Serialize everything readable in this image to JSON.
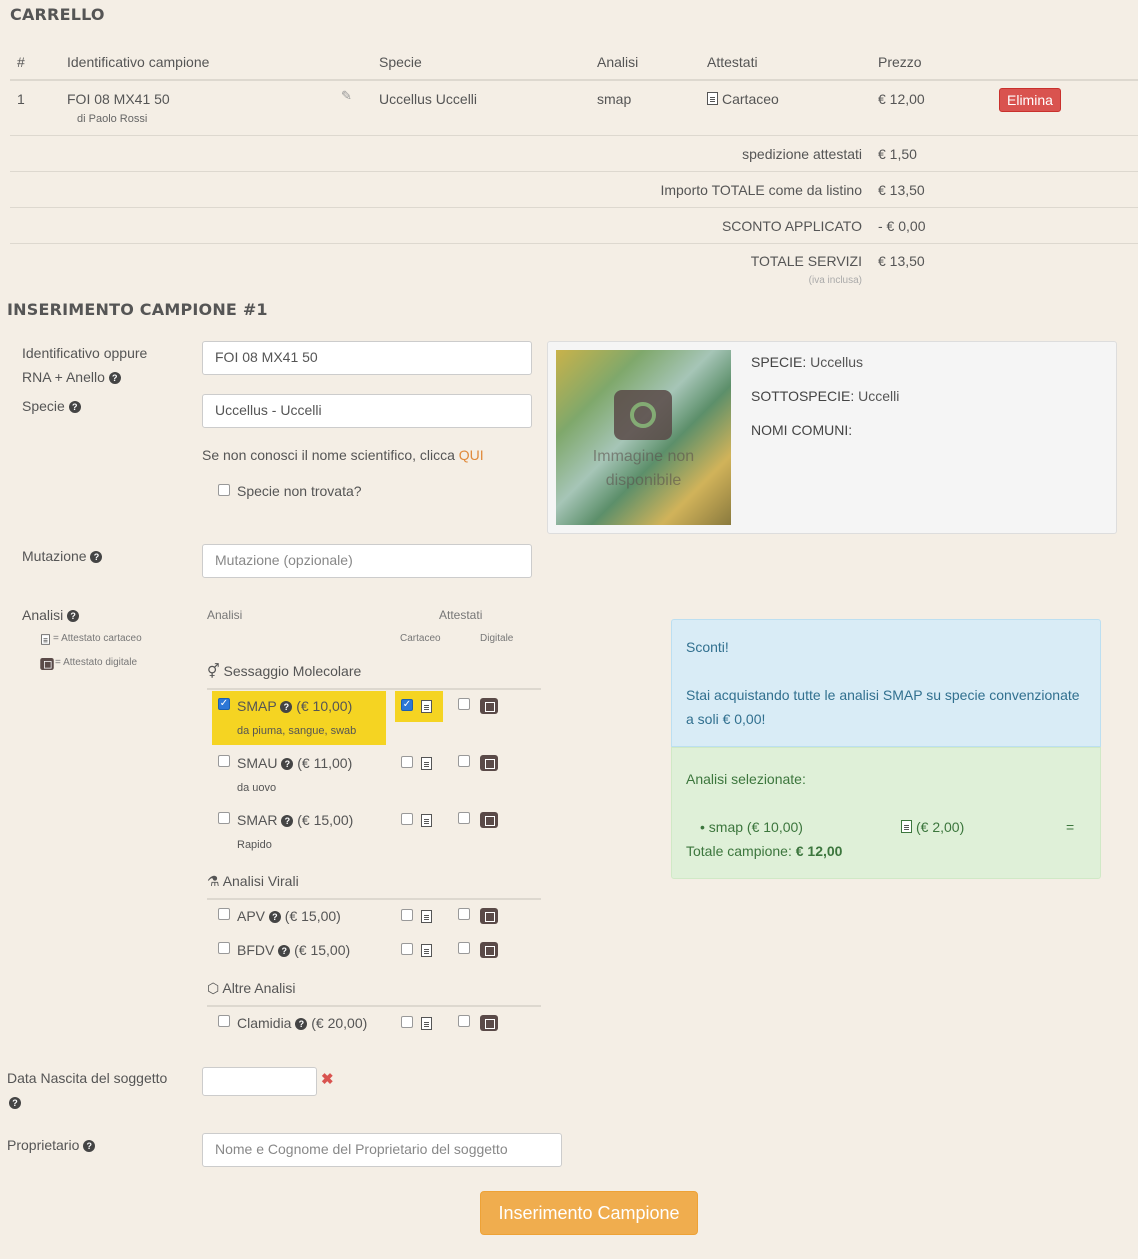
{
  "cart": {
    "title": "CARRELLO",
    "headers": [
      "#",
      "Identificativo campione",
      "Specie",
      "Analisi",
      "Attestati",
      "Prezzo"
    ],
    "row": {
      "num": "1",
      "id": "FOI 08 MX41 50",
      "by": "di Paolo Rossi",
      "species": "Uccellus Uccelli",
      "analysis": "smap",
      "cert": "Cartaceo",
      "price": "€ 12,00",
      "delete_label": "Elimina"
    },
    "summary": [
      {
        "label": "spedizione attestati",
        "value": "€ 1,50"
      },
      {
        "label": "Importo TOTALE come da listino",
        "value": "€ 13,50"
      },
      {
        "label": "SCONTO APPLICATO",
        "value": "- € 0,00"
      },
      {
        "label": "TOTALE SERVIZI",
        "value": "€ 13,50"
      }
    ],
    "vat_note": "(iva inclusa)"
  },
  "form": {
    "title": "INSERIMENTO CAMPIONE #1",
    "id_label_1": "Identificativo oppure",
    "id_label_2": "RNA + Anello",
    "id_value": "FOI 08 MX41 50",
    "species_label": "Specie",
    "species_value": "Uccellus - Uccelli",
    "hint_text": "Se non conosci il nome scientifico, clicca",
    "hint_link": "QUI",
    "not_found_label": "Specie non trovata?",
    "mutation_label": "Mutazione",
    "mutation_placeholder": "Mutazione (opzionale)",
    "analysis_label": "Analisi",
    "legend_paper": "= Attestato cartaceo",
    "legend_digital": "= Attestato digitale",
    "col_analysis": "Analisi",
    "col_certs": "Attestati",
    "col_paper": "Cartaceo",
    "col_digital": "Digitale",
    "birth_label": "Data Nascita del soggetto",
    "owner_label": "Proprietario",
    "owner_placeholder": "Nome e Cognome del Proprietario del soggetto",
    "submit_label": "Inserimento Campione"
  },
  "species_card": {
    "image_text_1": "Immagine non",
    "image_text_2": "disponibile",
    "species_key": "SPECIE:",
    "species_val": "Uccellus",
    "subspecies_key": "SOTTOSPECIE:",
    "subspecies_val": "Uccelli",
    "common_key": "NOMI COMUNI:"
  },
  "groups": {
    "molecular": "Sessaggio Molecolare",
    "viral": "Analisi Virali",
    "other": "Altre Analisi"
  },
  "analyses": {
    "smap": {
      "name": "SMAP",
      "price": "(€ 10,00)",
      "desc": "da piuma, sangue, swab"
    },
    "smau": {
      "name": "SMAU",
      "price": "(€ 11,00)",
      "desc": "da uovo"
    },
    "smar": {
      "name": "SMAR",
      "price": "(€ 15,00)",
      "desc": "Rapido"
    },
    "apv": {
      "name": "APV",
      "price": "(€ 15,00)"
    },
    "bfdv": {
      "name": "BFDV",
      "price": "(€ 15,00)"
    },
    "clamidia": {
      "name": "Clamidia",
      "price": "(€ 20,00)"
    }
  },
  "discount_box": {
    "title": "Sconti!",
    "text_1": "Stai acquistando tutte le analisi SMAP su specie convenzionate",
    "text_2": "a soli € 0,00!"
  },
  "selected_box": {
    "title": "Analisi selezionate:",
    "item": "• smap (€ 10,00)",
    "item_cert": "(€ 2,00)",
    "eq": "=",
    "total_label": "Totale campione:",
    "total_value": "€ 12,00"
  },
  "colors": {
    "bg": "#f4eee5",
    "accent_orange": "#f0ad4e",
    "danger": "#d9534f",
    "highlight": "#f5d422",
    "link": "#e08a3c"
  }
}
